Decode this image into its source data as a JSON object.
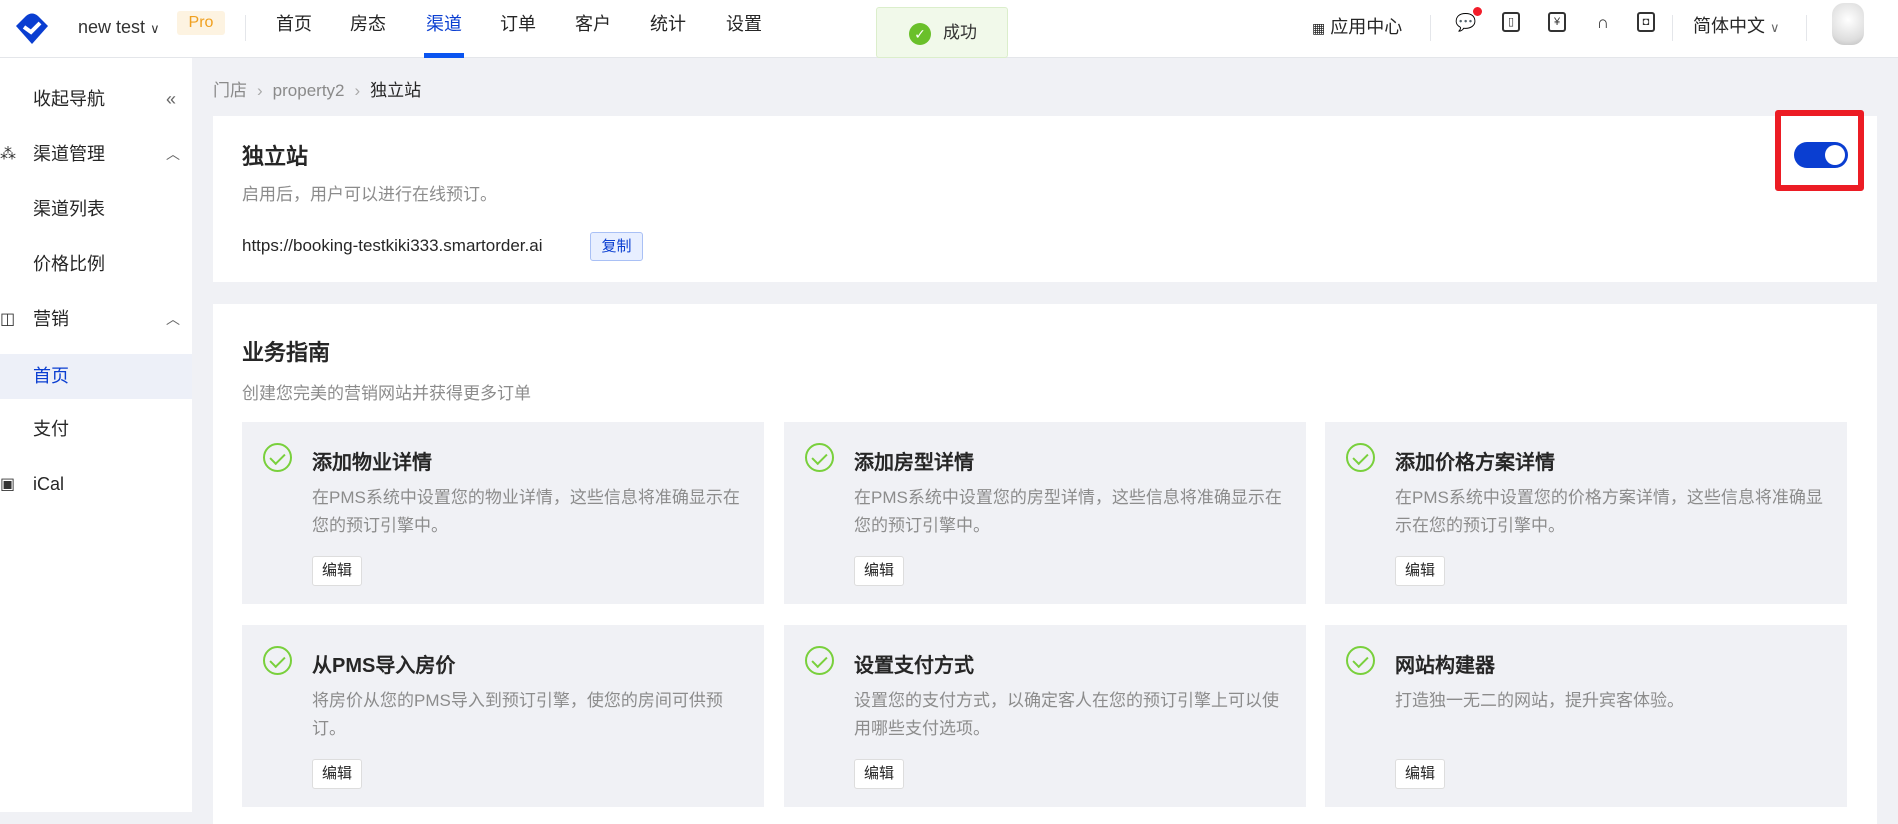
{
  "header": {
    "store": "new test",
    "badge": "Pro",
    "nav": [
      "首页",
      "房态",
      "渠道",
      "订单",
      "客户",
      "统计",
      "设置"
    ],
    "active_nav": 2,
    "toast": "成功",
    "app_center": "应用中心",
    "language": "简体中文"
  },
  "sidebar": {
    "collapse": "收起导航",
    "items": [
      {
        "label": "渠道管理",
        "icon": "channel-icon",
        "group": true
      },
      {
        "label": "渠道列表"
      },
      {
        "label": "价格比例"
      },
      {
        "label": "营销",
        "icon": "layout-icon",
        "group": true
      },
      {
        "label": "首页",
        "active": true
      },
      {
        "label": "支付"
      },
      {
        "label": "iCal",
        "icon": "calendar-icon",
        "group": true
      }
    ]
  },
  "breadcrumb": [
    "门店",
    "property2",
    "独立站"
  ],
  "site": {
    "title": "独立站",
    "desc": "启用后，用户可以进行在线预订。",
    "url": "https://booking-testkiki333.smartorder.ai",
    "copy": "复制",
    "enabled": true
  },
  "guide": {
    "title": "业务指南",
    "desc": "创建您完美的营销网站并获得更多订单",
    "edit": "编辑",
    "cards": [
      {
        "title": "添加物业详情",
        "desc": "在PMS系统中设置您的物业详情，这些信息将准确显示在您的预订引擎中。"
      },
      {
        "title": "添加房型详情",
        "desc": "在PMS系统中设置您的房型详情，这些信息将准确显示在您的预订引擎中。"
      },
      {
        "title": "添加价格方案详情",
        "desc": "在PMS系统中设置您的价格方案详情，这些信息将准确显示在您的预订引擎中。"
      },
      {
        "title": "从PMS导入房价",
        "desc": "将房价从您的PMS导入到预订引擎，使您的房间可供预订。"
      },
      {
        "title": "设置支付方式",
        "desc": "设置您的支付方式，以确定客人在您的预订引擎上可以使用哪些支付选项。"
      },
      {
        "title": "网站构建器",
        "desc": "打造独一无二的网站，提升宾客体验。"
      }
    ]
  }
}
